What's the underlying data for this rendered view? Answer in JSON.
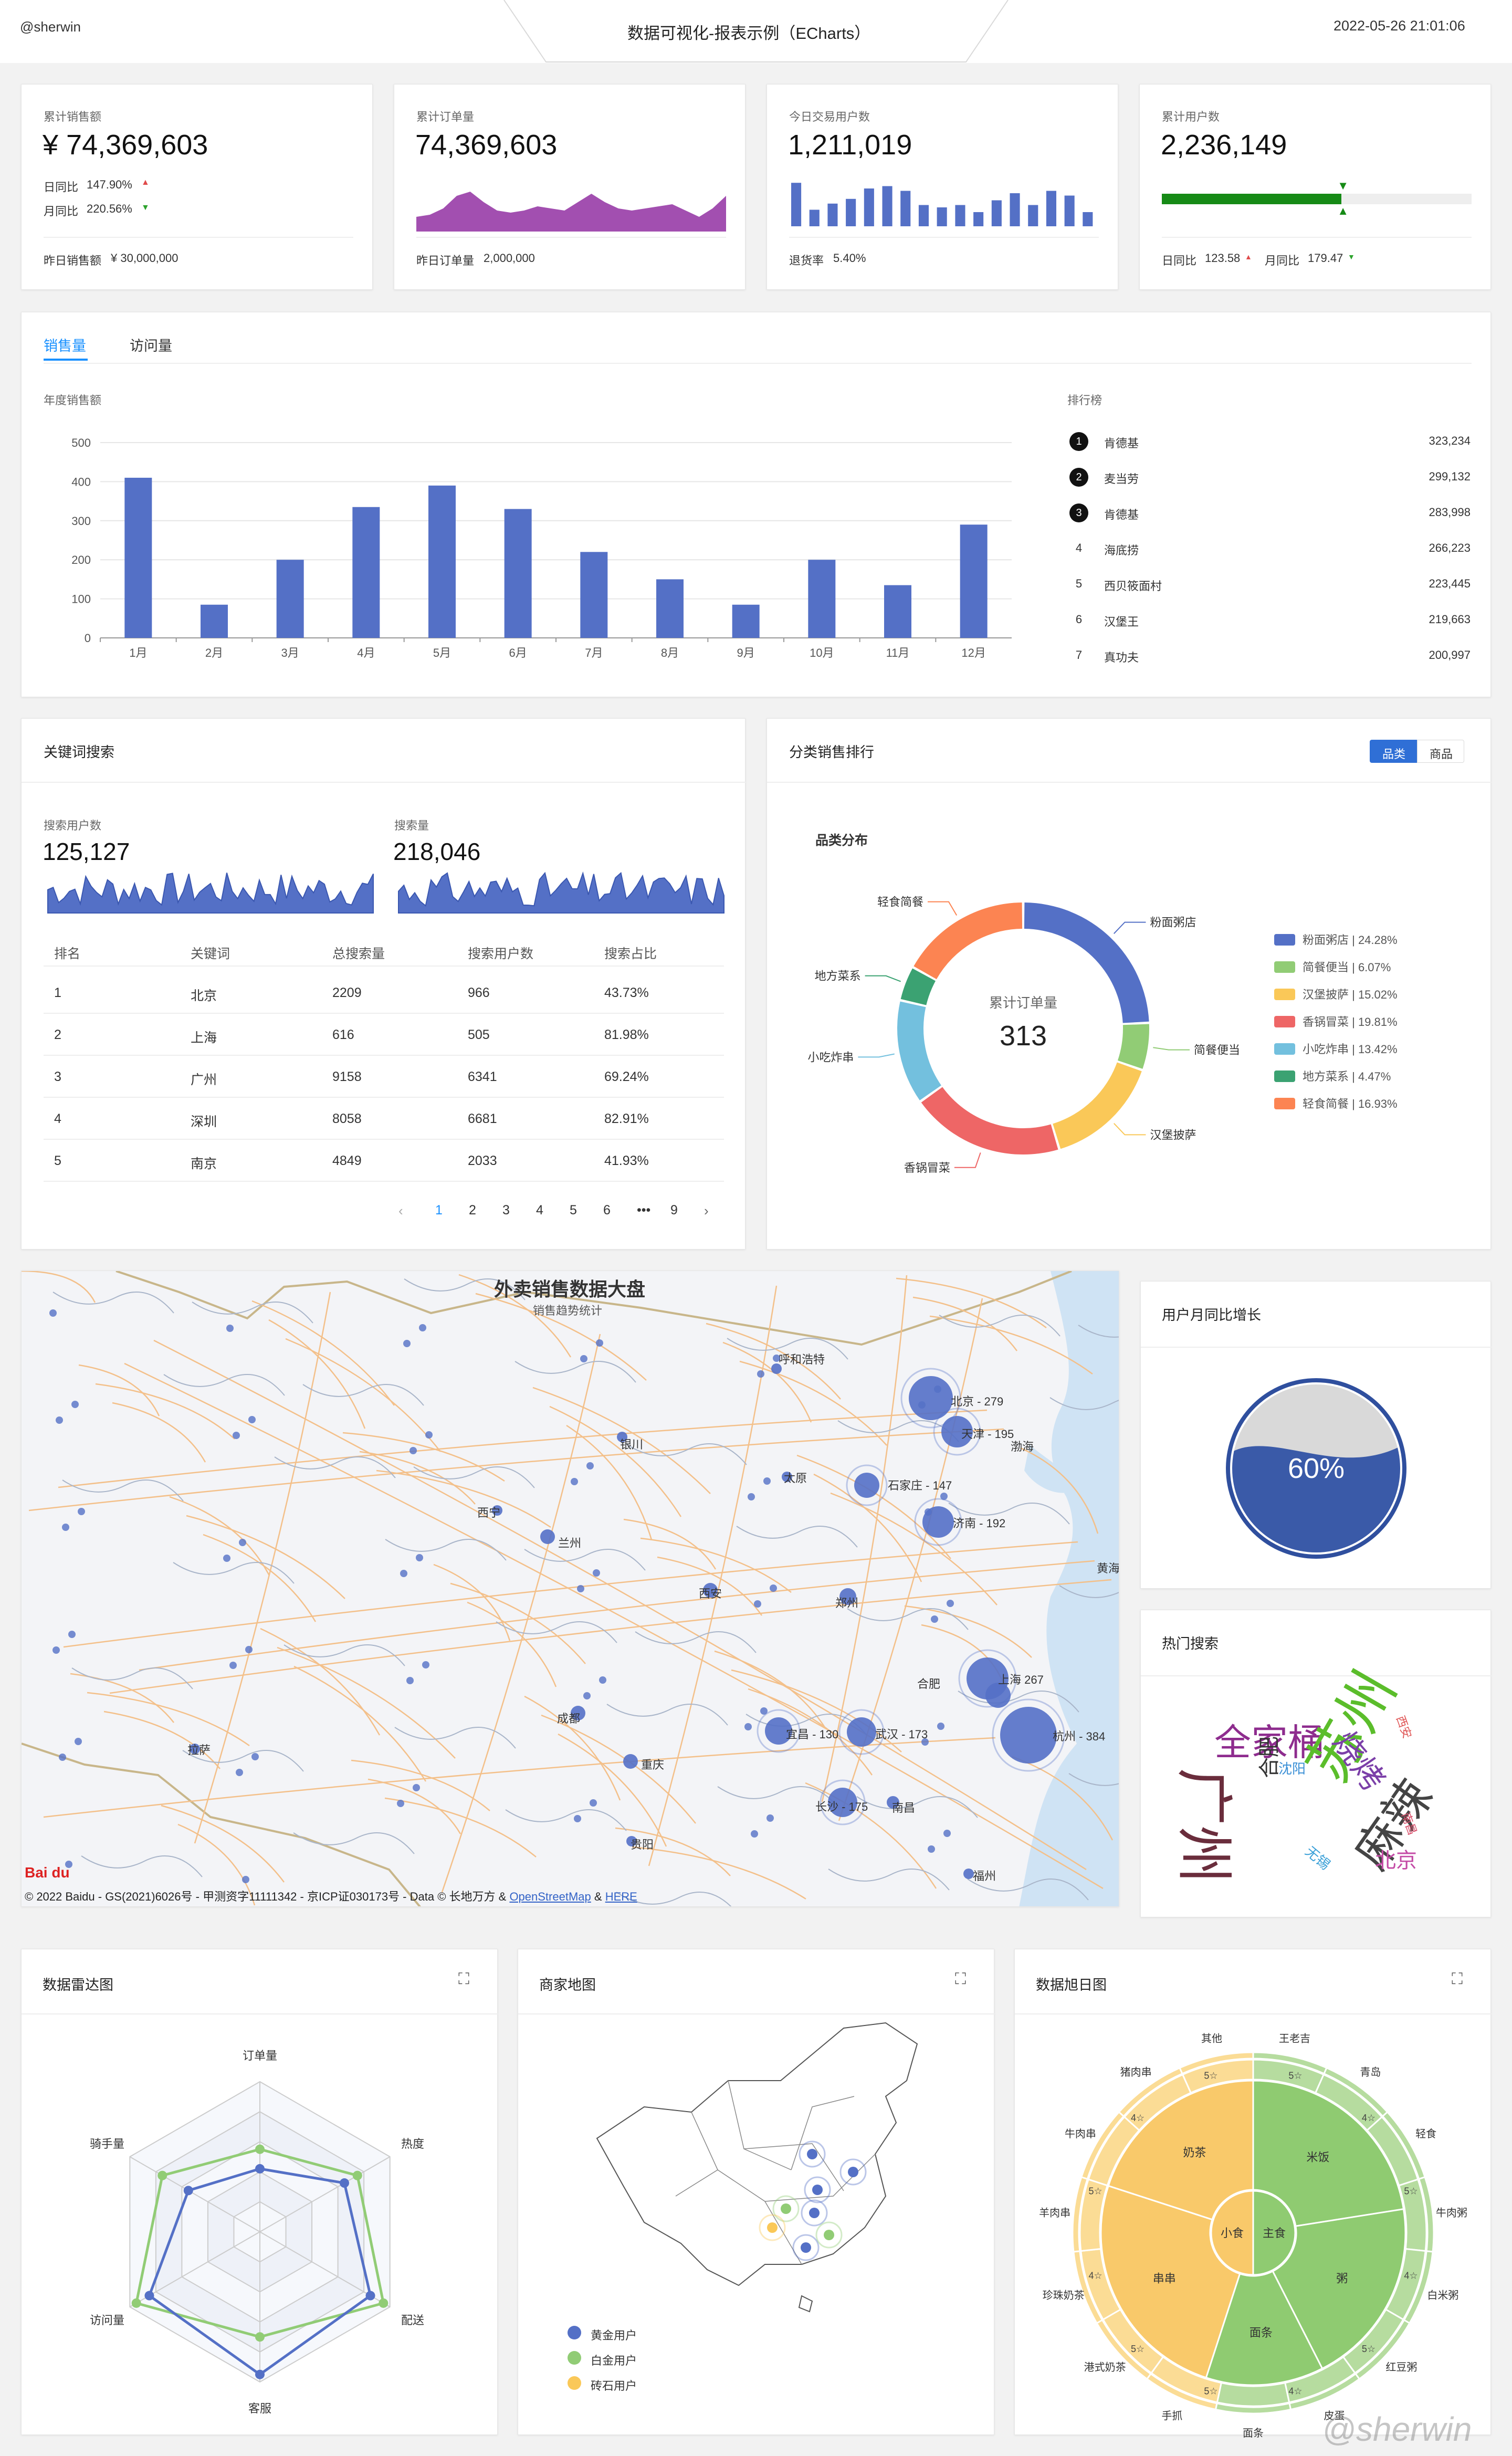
{
  "header": {
    "user": "@sherwin",
    "title": "数据可视化-报表示例（ECharts）",
    "datetime": "2022-05-26 21:01:06"
  },
  "kpi": {
    "sales": {
      "label": "累计销售额",
      "value": "¥ 74,369,603",
      "day_label": "日同比",
      "day_value": "147.90%",
      "month_label": "月同比",
      "month_value": "220.56%",
      "footer_label": "昨日销售额",
      "footer_value": "¥ 30,000,000"
    },
    "orders": {
      "label": "累计订单量",
      "value": "74,369,603",
      "footer_label": "昨日订单量",
      "footer_value": "2,000,000",
      "area_values": [
        0.35,
        0.4,
        0.55,
        0.85,
        0.95,
        0.7,
        0.5,
        0.45,
        0.5,
        0.6,
        0.55,
        0.5,
        0.7,
        0.9,
        0.7,
        0.55,
        0.5,
        0.55,
        0.6,
        0.65,
        0.5,
        0.35,
        0.55,
        0.85
      ]
    },
    "users_today": {
      "label": "今日交易用户数",
      "value": "1,211,019",
      "footer_label": "退货率",
      "footer_value": "5.40%",
      "bar_values": [
        0.92,
        0.35,
        0.48,
        0.58,
        0.8,
        0.85,
        0.75,
        0.45,
        0.4,
        0.45,
        0.3,
        0.55,
        0.7,
        0.45,
        0.75,
        0.65,
        0.3
      ]
    },
    "users_total": {
      "label": "累计用户数",
      "value": "2,236,149",
      "progress": 0.58,
      "day_label": "日同比",
      "day_value": "123.58",
      "month_label": "月同比",
      "month_value": "179.47"
    }
  },
  "sales_panel": {
    "tabs": [
      "销售量",
      "访问量"
    ],
    "chart_title": "年度销售额",
    "ranking_title": "排行榜",
    "ranking": [
      {
        "rank": "1",
        "name": "肯德基",
        "value": "323,234"
      },
      {
        "rank": "2",
        "name": "麦当劳",
        "value": "299,132"
      },
      {
        "rank": "3",
        "name": "肯德基",
        "value": "283,998"
      },
      {
        "rank": "4",
        "name": "海底捞",
        "value": "266,223"
      },
      {
        "rank": "5",
        "name": "西贝筱面村",
        "value": "223,445"
      },
      {
        "rank": "6",
        "name": "汉堡王",
        "value": "219,663"
      },
      {
        "rank": "7",
        "name": "真功夫",
        "value": "200,997"
      }
    ]
  },
  "chart_data": [
    {
      "type": "bar",
      "title": "年度销售额",
      "categories": [
        "1月",
        "2月",
        "3月",
        "4月",
        "5月",
        "6月",
        "7月",
        "8月",
        "9月",
        "10月",
        "11月",
        "12月"
      ],
      "values": [
        410,
        85,
        200,
        335,
        390,
        330,
        220,
        150,
        85,
        200,
        135,
        290
      ],
      "ylim": [
        0,
        500
      ],
      "yticks": [
        "0",
        "100",
        "200",
        "300",
        "400",
        "500"
      ],
      "color": "#5470c6"
    },
    {
      "type": "pie",
      "title": "品类分布",
      "center_label": "累计订单量",
      "center_value": "313",
      "slices": [
        {
          "name": "粉面粥店",
          "pct": "24.28%",
          "value": 24.28,
          "color": "#5470c6"
        },
        {
          "name": "简餐便当",
          "pct": "6.07%",
          "value": 6.07,
          "color": "#91cc75"
        },
        {
          "name": "汉堡披萨",
          "pct": "15.02%",
          "value": 15.02,
          "color": "#fac858"
        },
        {
          "name": "香锅冒菜",
          "pct": "19.81%",
          "value": 19.81,
          "color": "#ee6666"
        },
        {
          "name": "小吃炸串",
          "pct": "13.42%",
          "value": 13.42,
          "color": "#73c0de"
        },
        {
          "name": "地方菜系",
          "pct": "4.47%",
          "value": 4.47,
          "color": "#3ba272"
        },
        {
          "name": "轻食简餐",
          "pct": "16.93%",
          "value": 16.93,
          "color": "#fc8452"
        }
      ]
    },
    {
      "type": "radar",
      "title": "数据雷达图",
      "indicators": [
        "订单量",
        "热度",
        "配送",
        "客服",
        "访问量",
        "骑手量"
      ],
      "series": [
        {
          "color": "#91cc75",
          "values": [
            0.55,
            0.75,
            0.95,
            0.7,
            0.95,
            0.75
          ]
        },
        {
          "color": "#5470c6",
          "values": [
            0.42,
            0.65,
            0.85,
            0.95,
            0.85,
            0.55
          ]
        }
      ]
    }
  ],
  "keyword_panel": {
    "title": "关键词搜索",
    "users_label": "搜索用户数",
    "users_value": "125,127",
    "search_label": "搜索量",
    "search_value": "218,046",
    "columns": [
      "排名",
      "关键词",
      "总搜索量",
      "搜索用户数",
      "搜索占比"
    ],
    "rows": [
      [
        "1",
        "北京",
        "2209",
        "966",
        "43.73%"
      ],
      [
        "2",
        "上海",
        "616",
        "505",
        "81.98%"
      ],
      [
        "3",
        "广州",
        "9158",
        "6341",
        "69.24%"
      ],
      [
        "4",
        "深圳",
        "8058",
        "6681",
        "82.91%"
      ],
      [
        "5",
        "南京",
        "4849",
        "2033",
        "41.93%"
      ]
    ],
    "pages": [
      "1",
      "2",
      "3",
      "4",
      "5",
      "6",
      "•••",
      "9"
    ],
    "prev": "‹",
    "next": "›"
  },
  "category_panel": {
    "title": "分类销售排行",
    "toggle": [
      "品类",
      "商品"
    ]
  },
  "map_panel": {
    "title": "外卖销售数据大盘",
    "subtitle": "销售趋势统计",
    "labels": [
      {
        "text": "呼和浩特"
      },
      {
        "text": "北京 - 279"
      },
      {
        "text": "天津 - 195"
      },
      {
        "text": "银川"
      },
      {
        "text": "太原"
      },
      {
        "text": "石家庄 - 147"
      },
      {
        "text": "济南 - 192"
      },
      {
        "text": "西宁"
      },
      {
        "text": "兰州"
      },
      {
        "text": "西安"
      },
      {
        "text": "郑州"
      },
      {
        "text": "合肥"
      },
      {
        "text": "上海 267"
      },
      {
        "text": "成都"
      },
      {
        "text": "宜昌 - 130"
      },
      {
        "text": "武汉 - 173"
      },
      {
        "text": "杭州 - 384"
      },
      {
        "text": "重庆"
      },
      {
        "text": "长沙 - 175"
      },
      {
        "text": "南昌"
      },
      {
        "text": "贵阳"
      },
      {
        "text": "拉萨"
      },
      {
        "text": "福州"
      },
      {
        "text": "黄海"
      },
      {
        "text": "渤海"
      }
    ],
    "attribution": "© 2022 Baidu - GS(2021)6026号 - 甲测资字11111342 - 京ICP证030173号 - Data © 长地万方 &",
    "osm": "OpenStreetMap",
    "amp": "&",
    "here": "HERE",
    "logo": "Bai du"
  },
  "growth_panel": {
    "title": "用户月同比增长",
    "value": "60%",
    "fill": 0.6
  },
  "hot_panel": {
    "title": "热门搜索",
    "words": [
      {
        "text": "全家桶",
        "color": "#8e2c8e"
      },
      {
        "text": "苏州",
        "color": "#5bbd2b"
      },
      {
        "text": "广州",
        "color": "#6a2d3c"
      },
      {
        "text": "麻辣",
        "color": "#444444"
      },
      {
        "text": "烧烤",
        "color": "#7b3fa8"
      },
      {
        "text": "合肥",
        "color": "#333333"
      },
      {
        "text": "沈阳",
        "color": "#3a8fd6"
      },
      {
        "text": "北京",
        "color": "#c44ba6"
      },
      {
        "text": "无锡",
        "color": "#3aa0d8"
      },
      {
        "text": "西安",
        "color": "#e05757"
      },
      {
        "text": "南昌",
        "color": "#d94f6b"
      }
    ]
  },
  "radar_panel": {
    "title": "数据雷达图"
  },
  "merchant_panel": {
    "title": "商家地图",
    "legend": [
      {
        "text": "黄金用户",
        "color": "#5470c6"
      },
      {
        "text": "白金用户",
        "color": "#91cc75"
      },
      {
        "text": "砖石用户",
        "color": "#fac858"
      }
    ]
  },
  "sunburst_panel": {
    "title": "数据旭日图",
    "inner": [
      "小食",
      "主食"
    ],
    "middle": [
      "串串",
      "奶茶",
      "米饭",
      "粥",
      "面条"
    ],
    "outer": [
      "王老吉",
      "青岛",
      "轻食",
      "牛肉粥",
      "白米粥",
      "红豆粥",
      "皮蛋",
      "面条",
      "手抓",
      "港式奶茶",
      "珍珠奶茶",
      "羊肉串",
      "牛肉串",
      "猪肉串",
      "其他"
    ],
    "stars": [
      "5☆",
      "4☆",
      "5☆",
      "4☆",
      "5☆",
      "4☆",
      "5☆",
      "5☆",
      "4☆",
      "5☆",
      "4☆",
      "5☆"
    ]
  },
  "watermark": "@sherwin"
}
